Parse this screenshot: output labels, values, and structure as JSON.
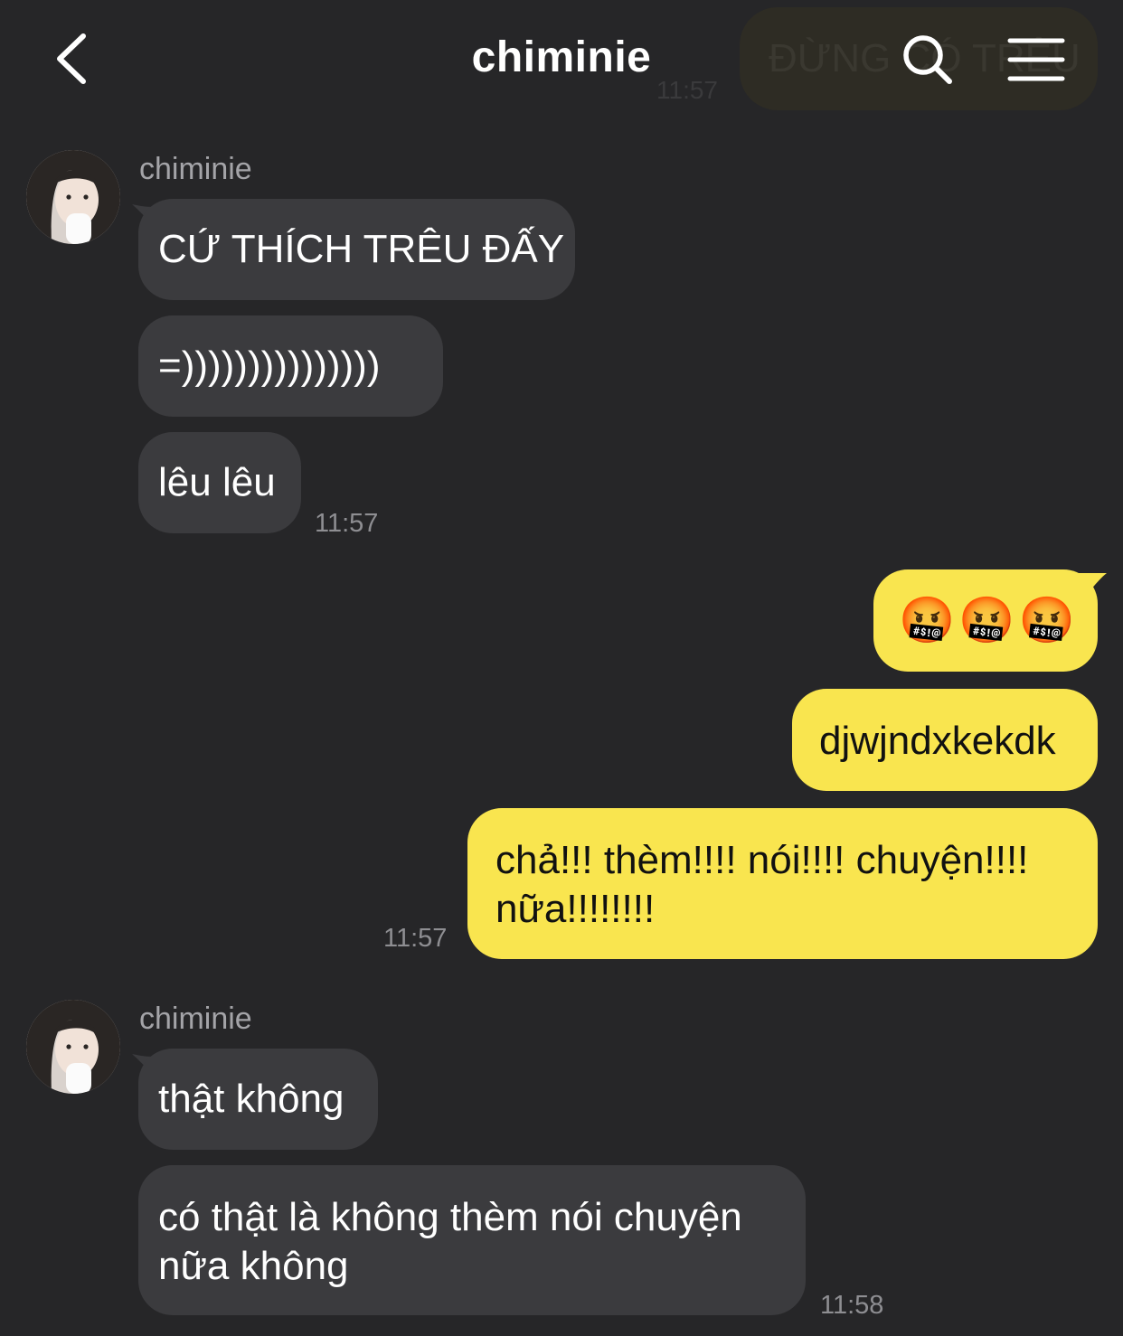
{
  "header": {
    "title": "chiminie",
    "ghost_text": "ĐỪNG CÓ TRÊU",
    "ghost_time": "11:57"
  },
  "messages": {
    "group1": {
      "sender": "chiminie",
      "m1": "CỨ THÍCH TRÊU ĐẤY",
      "m2": "=)))))))))))))))",
      "m3": "lêu lêu",
      "time": "11:57"
    },
    "group2": {
      "m1_emoji": [
        "🤬",
        "🤬",
        "🤬"
      ],
      "m2": "djwjndxkekdk",
      "m3_line1": "chả!!! thèm!!!! nói!!!! chuyện!!!!",
      "m3_line2": "nữa!!!!!!!!",
      "time": "11:57"
    },
    "group3": {
      "sender": "chiminie",
      "m1": "thật không",
      "m2_line1": "có thật là không thèm nói chuyện",
      "m2_line2": "nữa không",
      "time": "11:58"
    }
  },
  "colors": {
    "background": "#262628",
    "incoming_bubble": "#3b3b3e",
    "outgoing_bubble": "#f9e54f",
    "timestamp": "#8e8e92"
  },
  "icons": [
    "chevron-left-icon",
    "search-icon",
    "hamburger-menu-icon",
    "angry-cursing-face-icon"
  ]
}
